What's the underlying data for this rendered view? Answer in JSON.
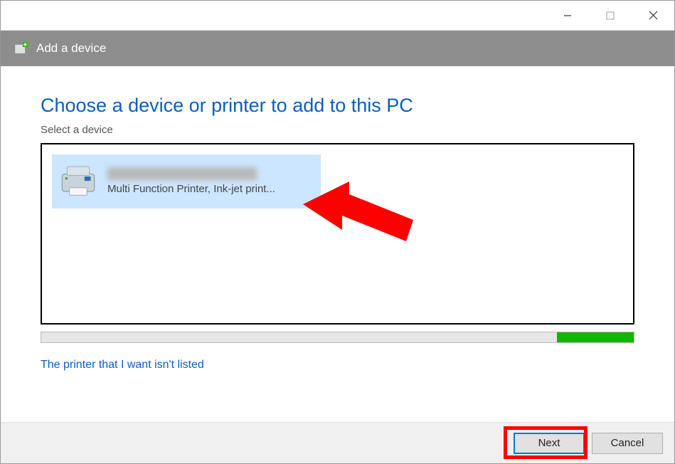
{
  "window": {
    "title": "Add a device"
  },
  "main": {
    "heading": "Choose a device or printer to add to this PC",
    "subheading": "Select a device",
    "device": {
      "name_blurred": "",
      "description": "Multi Function Printer, Ink-jet print..."
    },
    "link_not_listed": "The printer that I want isn't listed"
  },
  "footer": {
    "next": "Next",
    "cancel": "Cancel"
  }
}
